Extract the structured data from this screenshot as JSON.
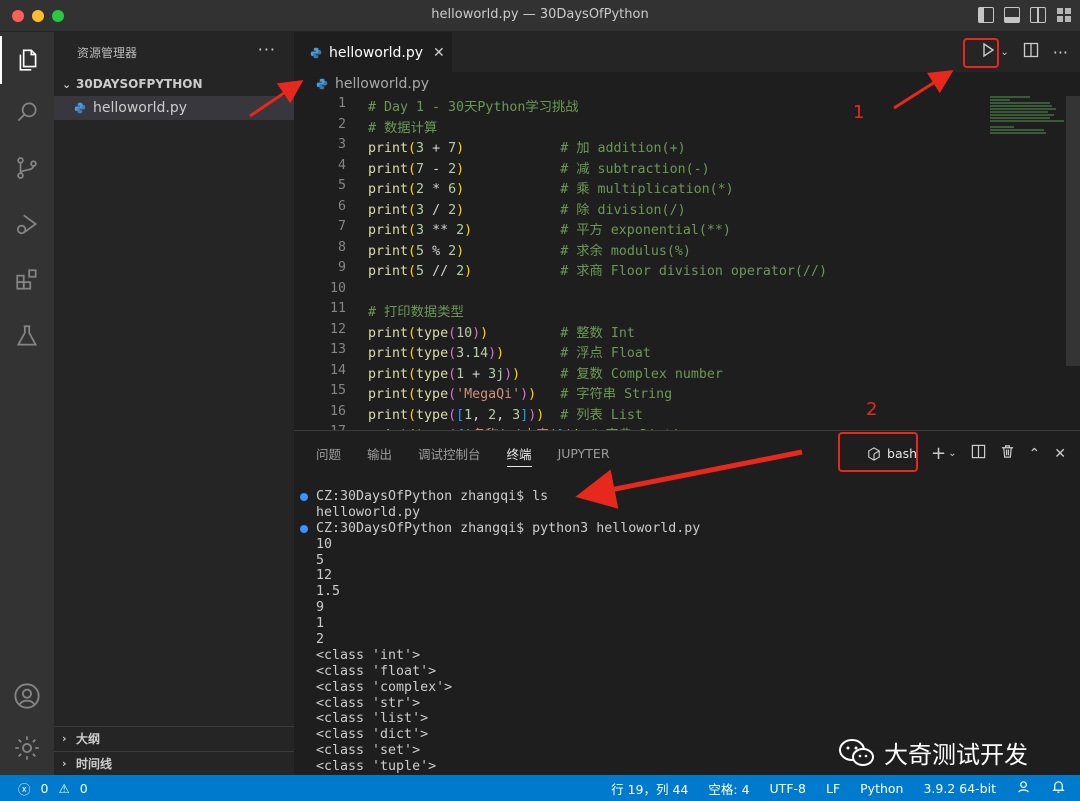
{
  "window": {
    "title": "helloworld.py — 30DaysOfPython"
  },
  "sidebar": {
    "header": "资源管理器",
    "folder": "30DAYSOFPYTHON",
    "file": "helloworld.py",
    "outline": "大纲",
    "timeline": "时间线"
  },
  "editor": {
    "tab_label": "helloworld.py",
    "breadcrumb": "helloworld.py",
    "lines": [
      {
        "n": "1",
        "code": "# Day 1 - 30天Python学习挑战"
      },
      {
        "n": "2",
        "code": "# 数据计算"
      },
      {
        "n": "3",
        "code": "print(3 + 7)            # 加 addition(+)"
      },
      {
        "n": "4",
        "code": "print(7 - 2)            # 减 subtraction(-)"
      },
      {
        "n": "5",
        "code": "print(2 * 6)            # 乘 multiplication(*)"
      },
      {
        "n": "6",
        "code": "print(3 / 2)            # 除 division(/)"
      },
      {
        "n": "7",
        "code": "print(3 ** 2)           # 平方 exponential(**)"
      },
      {
        "n": "8",
        "code": "print(5 % 2)            # 求余 modulus(%)"
      },
      {
        "n": "9",
        "code": "print(5 // 2)           # 求商 Floor division operator(//)"
      },
      {
        "n": "10",
        "code": ""
      },
      {
        "n": "11",
        "code": "# 打印数据类型"
      },
      {
        "n": "12",
        "code": "print(type(10))         # 整数 Int"
      },
      {
        "n": "13",
        "code": "print(type(3.14))       # 浮点 Float"
      },
      {
        "n": "14",
        "code": "print(type(1 + 3j))     # 复数 Complex number"
      },
      {
        "n": "15",
        "code": "print(type('MegaQi'))   # 字符串 String"
      },
      {
        "n": "16",
        "code": "print(type([1, 2, 3]))  # 列表 List"
      },
      {
        "n": "17",
        "code": "print(type({'名称':'大奇'})) # 字典 Dictionary"
      }
    ]
  },
  "panel": {
    "tabs": [
      "问题",
      "输出",
      "调试控制台",
      "终端",
      "JUPYTER"
    ],
    "active_tab": "终端",
    "shell": "bash",
    "terminal_lines": [
      "CZ:30DaysOfPython zhangqi$ ls",
      "helloworld.py",
      "CZ:30DaysOfPython zhangqi$ python3 helloworld.py",
      "10",
      "5",
      "12",
      "1.5",
      "9",
      "1",
      "2",
      "<class 'int'>",
      "<class 'float'>",
      "<class 'complex'>",
      "<class 'str'>",
      "<class 'list'>",
      "<class 'dict'>",
      "<class 'set'>",
      "<class 'tuple'>"
    ]
  },
  "statusbar": {
    "errors": "0",
    "warnings": "0",
    "position": "行 19，列 44",
    "spaces": "空格: 4",
    "encoding": "UTF-8",
    "eol": "LF",
    "language": "Python",
    "interpreter": "3.9.2 64-bit"
  },
  "annotations": {
    "label_1": "1",
    "label_2": "2"
  },
  "watermark": {
    "text": "大奇测试开发"
  },
  "colors": {
    "accent": "#007acc",
    "annotation": "#e8271d"
  }
}
